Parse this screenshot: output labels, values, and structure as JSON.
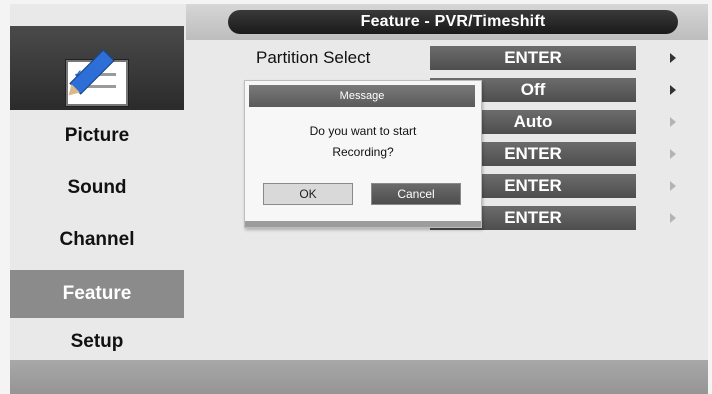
{
  "header": {
    "title": "Feature - PVR/Timeshift"
  },
  "sidebar": {
    "icon": "feature-edit-icon",
    "items": [
      {
        "label": "Picture",
        "active": false
      },
      {
        "label": "Sound",
        "active": false
      },
      {
        "label": "Channel",
        "active": false
      },
      {
        "label": "Feature",
        "active": true
      },
      {
        "label": "Setup",
        "active": false
      }
    ]
  },
  "feature_rows": [
    {
      "label": "Partition Select",
      "value": "ENTER",
      "arrow": "right-arrow-icon"
    },
    {
      "label": "",
      "value": "Off",
      "arrow": "right-arrow-icon"
    },
    {
      "label": "",
      "value": "Auto",
      "arrow": "right-arrow-icon"
    },
    {
      "label": "",
      "value": "ENTER",
      "arrow": "right-arrow-icon"
    },
    {
      "label": "",
      "value": "ENTER",
      "arrow": "right-arrow-icon"
    },
    {
      "label": "",
      "value": "ENTER",
      "arrow": "right-arrow-icon"
    }
  ],
  "dialog": {
    "title": "Message",
    "message_line1": "Do you want to start",
    "message_line2": "Recording?",
    "ok_label": "OK",
    "cancel_label": "Cancel"
  },
  "colors": {
    "active_item": "#8b8b8b",
    "value_button": "#5a5a5a",
    "title_pill": "#222222"
  }
}
